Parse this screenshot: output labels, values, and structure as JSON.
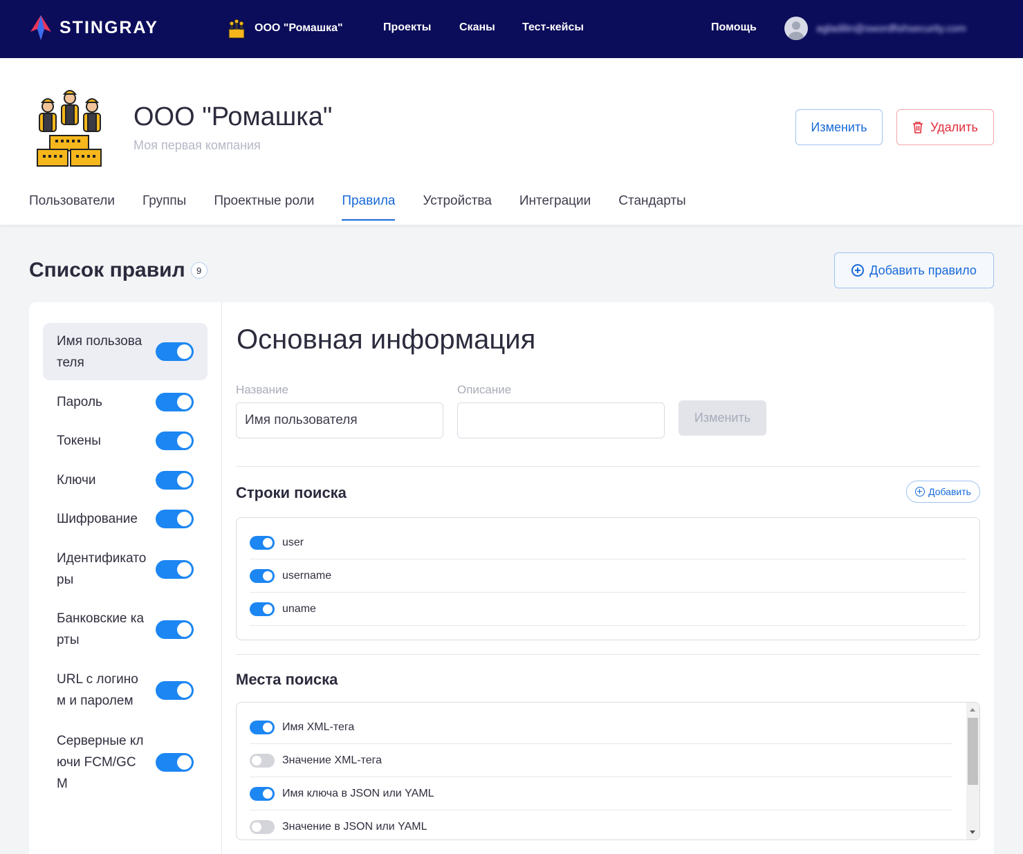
{
  "topbar": {
    "brand": "STINGRAY",
    "company": "ООО \"Ромашка\"",
    "nav": [
      "Проекты",
      "Сканы",
      "Тест-кейсы"
    ],
    "help": "Помощь",
    "user_email": "agladilin@swordfishsecurity.com",
    "bg_color": "#0b0c5a"
  },
  "header": {
    "title": "ООО \"Ромашка\"",
    "subtitle": "Моя первая компания",
    "edit_label": "Изменить",
    "delete_label": "Удалить",
    "tabs": [
      "Пользователи",
      "Группы",
      "Проектные роли",
      "Правила",
      "Устройства",
      "Интеграции",
      "Стандарты"
    ],
    "active_tab": "Правила"
  },
  "rules_section": {
    "title": "Список правил",
    "count": "9",
    "add_label": "Добавить правило",
    "rules": [
      {
        "label": "Имя пользователя",
        "enabled": true,
        "active": true
      },
      {
        "label": "Пароль",
        "enabled": true
      },
      {
        "label": "Токены",
        "enabled": true
      },
      {
        "label": "Ключи",
        "enabled": true
      },
      {
        "label": "Шифрование",
        "enabled": true
      },
      {
        "label": "Идентификаторы",
        "enabled": true
      },
      {
        "label": "Банковские карты",
        "enabled": true
      },
      {
        "label": "URL с логином и паролем",
        "enabled": true
      },
      {
        "label": "Серверные ключи FCM/GCM",
        "enabled": true
      }
    ]
  },
  "detail": {
    "title": "Основная информация",
    "name_label": "Название",
    "name_value": "Имя пользователя",
    "desc_label": "Описание",
    "desc_value": "",
    "edit_label": "Изменить",
    "search_strings_title": "Строки поиска",
    "add_label": "Добавить",
    "search_strings": [
      {
        "label": "user",
        "enabled": true
      },
      {
        "label": "username",
        "enabled": true
      },
      {
        "label": "uname",
        "enabled": true
      }
    ],
    "search_places_title": "Места поиска",
    "search_places": [
      {
        "label": "Имя XML-тега",
        "enabled": true
      },
      {
        "label": "Значение XML-тега",
        "enabled": false
      },
      {
        "label": "Имя ключа в JSON или YAML",
        "enabled": true
      },
      {
        "label": "Значение в JSON или YAML",
        "enabled": false
      }
    ]
  },
  "colors": {
    "accent": "#1769d8",
    "toggle_on": "#1c86f2",
    "danger": "#e12d3a"
  }
}
